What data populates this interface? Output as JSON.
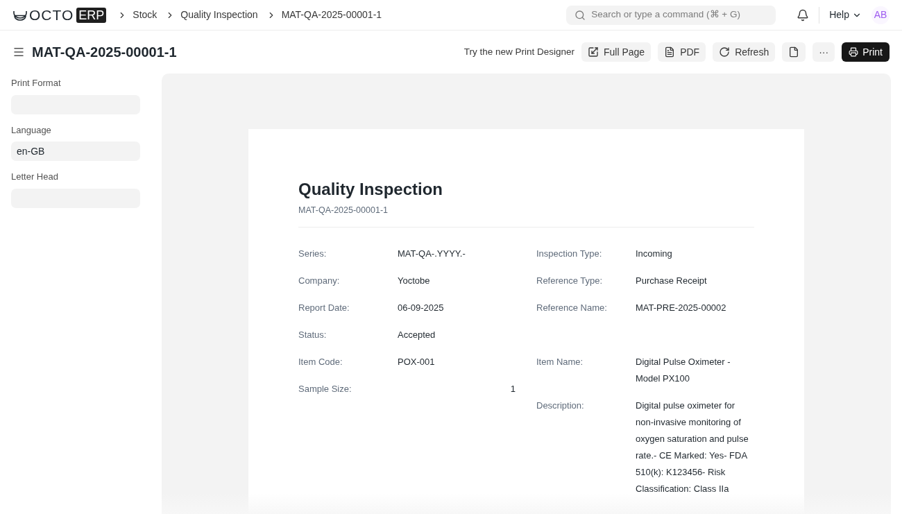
{
  "navbar": {
    "logo": {
      "text": "OCTO",
      "badge": "ERP"
    },
    "breadcrumbs": [
      "Stock",
      "Quality Inspection",
      "MAT-QA-2025-00001-1"
    ],
    "search": {
      "placeholder": "Search or type a command (⌘ + G)"
    },
    "help": "Help",
    "avatar": "AB"
  },
  "page_header": {
    "title": "MAT-QA-2025-00001-1",
    "designer_link": "Try the new Print Designer",
    "buttons": [
      {
        "kind": "full_page",
        "label": "Full Page"
      },
      {
        "kind": "pdf",
        "label": "PDF"
      },
      {
        "kind": "refresh",
        "label": "Refresh"
      },
      {
        "kind": "page"
      },
      {
        "kind": "more",
        "label": "···"
      },
      {
        "kind": "print",
        "label": "Print"
      }
    ]
  },
  "sidebar": {
    "fields": [
      {
        "label": "Print Format"
      },
      {
        "label": "Language",
        "value": "en-GB"
      },
      {
        "label": "Letter Head"
      }
    ]
  },
  "document": {
    "title": "Quality Inspection",
    "subtitle": "MAT-QA-2025-00001-1",
    "rows": [
      {
        "left": {
          "label": "Series:",
          "value": "MAT-QA-.YYYY.-"
        },
        "right": {
          "label": "Inspection Type:",
          "value": "Incoming"
        }
      },
      {
        "left": {
          "label": "Company:",
          "value": "Yoctobe"
        },
        "right": {
          "label": "Reference Type:",
          "value": "Purchase Receipt"
        }
      },
      {
        "left": {
          "label": "Report Date:",
          "value": "06-09-2025"
        },
        "right": {
          "label": "Reference Name:",
          "value": "MAT-PRE-2025-00002"
        }
      },
      {
        "left": {
          "label": "Status:",
          "value": "Accepted"
        }
      },
      {
        "left": {
          "label": "Item Code:",
          "value": "POX-001"
        },
        "right": {
          "label": "Item Name:",
          "value": "Digital Pulse Oximeter - Model PX100"
        }
      },
      {
        "left": {
          "label": "Sample Size:",
          "value": "1",
          "kind": "number"
        },
        "right": {
          "label": "Description:",
          "value": "Digital pulse oximeter for non-invasive monitoring of oxygen saturation and pulse rate.- CE Marked: Yes- FDA 510(k): K123456- Risk Classification: Class IIa"
        }
      }
    ]
  }
}
